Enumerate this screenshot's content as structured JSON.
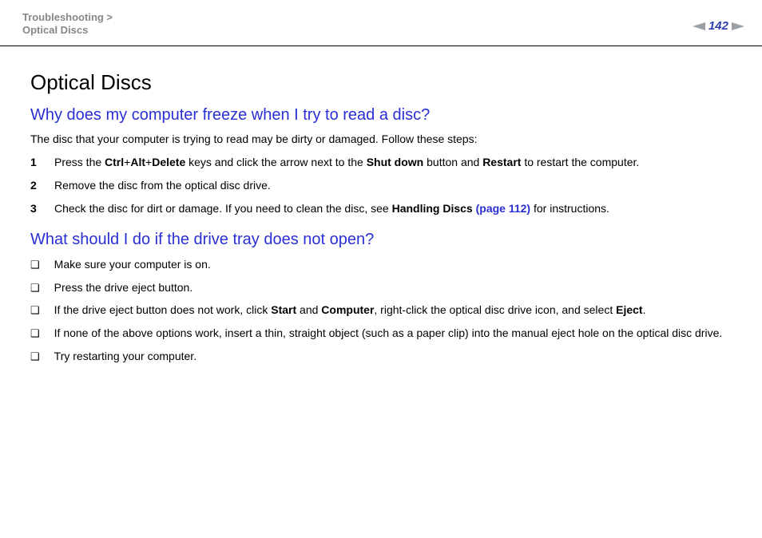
{
  "header": {
    "breadcrumb_line1": "Troubleshooting >",
    "breadcrumb_line2": "Optical Discs",
    "page_number": "142"
  },
  "content": {
    "title": "Optical Discs",
    "section1": {
      "heading": "Why does my computer freeze when I try to read a disc?",
      "intro": "The disc that your computer is trying to read may be dirty or damaged. Follow these steps:",
      "steps": [
        {
          "n": "1",
          "pre": "Press the ",
          "b1": "Ctrl",
          "c1": "+",
          "b2": "Alt",
          "c2": "+",
          "b3": "Delete",
          "mid": " keys and click the arrow next to the ",
          "b4": "Shut down",
          "mid2": " button and ",
          "b5": "Restart",
          "post": " to restart the computer."
        },
        {
          "n": "2",
          "text": "Remove the disc from the optical disc drive."
        },
        {
          "n": "3",
          "pre": "Check the disc for dirt or damage. If you need to clean the disc, see ",
          "b1": "Handling Discs ",
          "link": "(page 112)",
          "post": " for instructions."
        }
      ]
    },
    "section2": {
      "heading": "What should I do if the drive tray does not open?",
      "items": [
        {
          "text": "Make sure your computer is on."
        },
        {
          "text": "Press the drive eject button."
        },
        {
          "pre": "If the drive eject button does not work, click ",
          "b1": "Start",
          "mid1": " and ",
          "b2": "Computer",
          "mid2": ", right-click the optical disc drive icon, and select ",
          "b3": "Eject",
          "post": "."
        },
        {
          "text": "If none of the above options work, insert a thin, straight object (such as a paper clip) into the manual eject hole on the optical disc drive."
        },
        {
          "text": "Try restarting your computer."
        }
      ]
    }
  },
  "glyphs": {
    "box": "❑"
  }
}
